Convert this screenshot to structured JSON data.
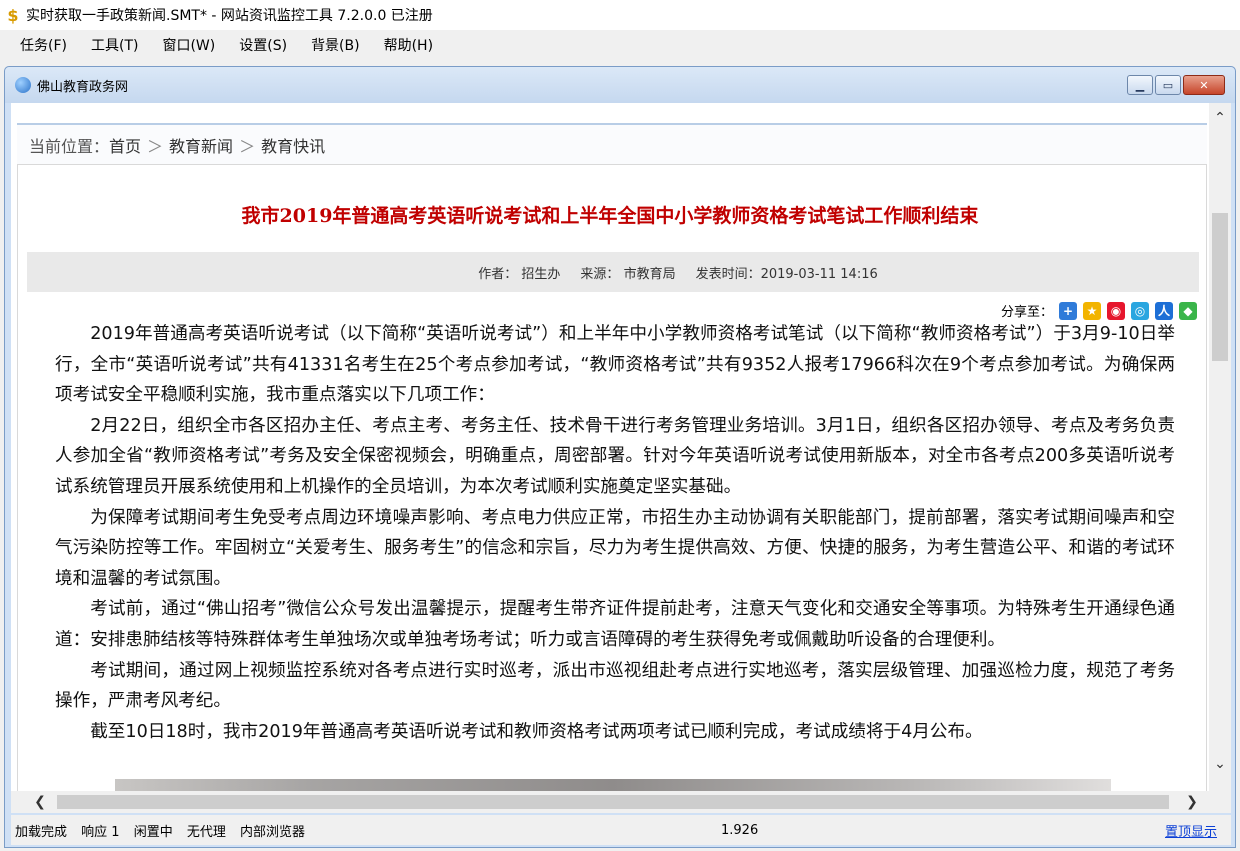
{
  "app": {
    "title": "实时获取一手政策新闻.SMT* - 网站资讯监控工具 7.2.0.0  已注册"
  },
  "menu": {
    "items": [
      "任务(F)",
      "工具(T)",
      "窗口(W)",
      "设置(S)",
      "背景(B)",
      "帮助(H)"
    ]
  },
  "child_window": {
    "title": "佛山教育政务网"
  },
  "breadcrumb": {
    "label": "当前位置：",
    "items": [
      "首页",
      "教育新闻",
      "教育快讯"
    ],
    "separator": "＞"
  },
  "article": {
    "title": "我市2019年普通高考英语听说考试和上半年全国中小学教师资格考试笔试工作顺利结束",
    "author_label": "作者：",
    "author": "招生办",
    "source_label": "来源：",
    "source": "市教育局",
    "date_label": "发表时间：",
    "date": "2019-03-11 14:16",
    "share_label": "分享至：",
    "paragraphs": [
      "2019年普通高考英语听说考试（以下简称“英语听说考试”）和上半年中小学教师资格考试笔试（以下简称“教师资格考试”）于3月9-10日举行，全市“英语听说考试”共有41331名考生在25个考点参加考试，“教师资格考试”共有9352人报考17966科次在9个考点参加考试。为确保两项考试安全平稳顺利实施，我市重点落实以下几项工作：",
      "2月22日，组织全市各区招办主任、考点主考、考务主任、技术骨干进行考务管理业务培训。3月1日，组织各区招办领导、考点及考务负责人参加全省“教师资格考试”考务及安全保密视频会，明确重点，周密部署。针对今年英语听说考试使用新版本，对全市各考点200多英语听说考试系统管理员开展系统使用和上机操作的全员培训，为本次考试顺利实施奠定坚实基础。",
      "为保障考试期间考生免受考点周边环境噪声影响、考点电力供应正常，市招生办主动协调有关职能部门，提前部署，落实考试期间噪声和空气污染防控等工作。牢固树立“关爱考生、服务考生”的信念和宗旨，尽力为考生提供高效、方便、快捷的服务，为考生营造公平、和谐的考试环境和温馨的考试氛围。",
      "考试前，通过“佛山招考”微信公众号发出温馨提示，提醒考生带齐证件提前赴考，注意天气变化和交通安全等事项。为特殊考生开通绿色通道：安排患肺结核等特殊群体考生单独场次或单独考场考试；听力或言语障碍的考生获得免考或佩戴助听设备的合理便利。",
      "考试期间，通过网上视频监控系统对各考点进行实时巡考，派出市巡视组赴考点进行实地巡考，落实层级管理、加强巡检力度，规范了考务操作，严肃考风考纪。",
      "截至10日18时，我市2019年普通高考英语听说考试和教师资格考试两项考试已顺利完成，考试成绩将于4月公布。"
    ]
  },
  "status": {
    "items": [
      "加载完成",
      "响应 1",
      "闲置中",
      "无代理",
      "内部浏览器"
    ],
    "number": "1.926",
    "link": "置顶显示"
  },
  "colors": {
    "title_red": "#c00000",
    "link_blue": "#0b3fd6"
  }
}
